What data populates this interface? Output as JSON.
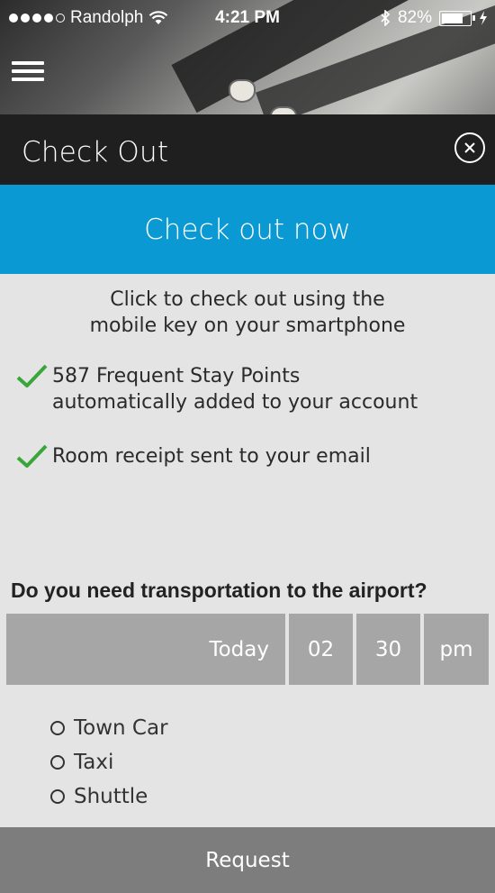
{
  "status_bar": {
    "carrier": "Randolph",
    "time": "4:21 PM",
    "battery_percent": "82%",
    "signal_dots_filled": 4,
    "signal_dots_total": 5,
    "battery_level": 0.82
  },
  "header": {
    "title": "Check Out",
    "menu_icon": "hamburger-menu-icon",
    "close_icon": "close-circle-icon"
  },
  "checkout": {
    "button_label": "Check out now",
    "intro_line1": "Click to check out using the",
    "intro_line2": "mobile key on your smartphone"
  },
  "benefits": [
    {
      "icon": "checkmark-icon",
      "line1": "587 Frequent Stay Points",
      "line2": "automatically added to your account"
    },
    {
      "icon": "checkmark-icon",
      "line1": "Room receipt sent to your email",
      "line2": ""
    }
  ],
  "transport": {
    "question": "Do you need transportation to the airport?",
    "day": "Today",
    "hour": "02",
    "minute": "30",
    "ampm": "pm",
    "options": [
      "Town Car",
      "Taxi",
      "Shuttle"
    ]
  },
  "footer": {
    "request_label": "Request"
  },
  "colors": {
    "accent_blue": "#0a99d2",
    "check_green": "#3aa63a",
    "button_gray": "#7d7d7d",
    "cell_gray": "#a6a6a6",
    "background": "#e4e4e4"
  }
}
